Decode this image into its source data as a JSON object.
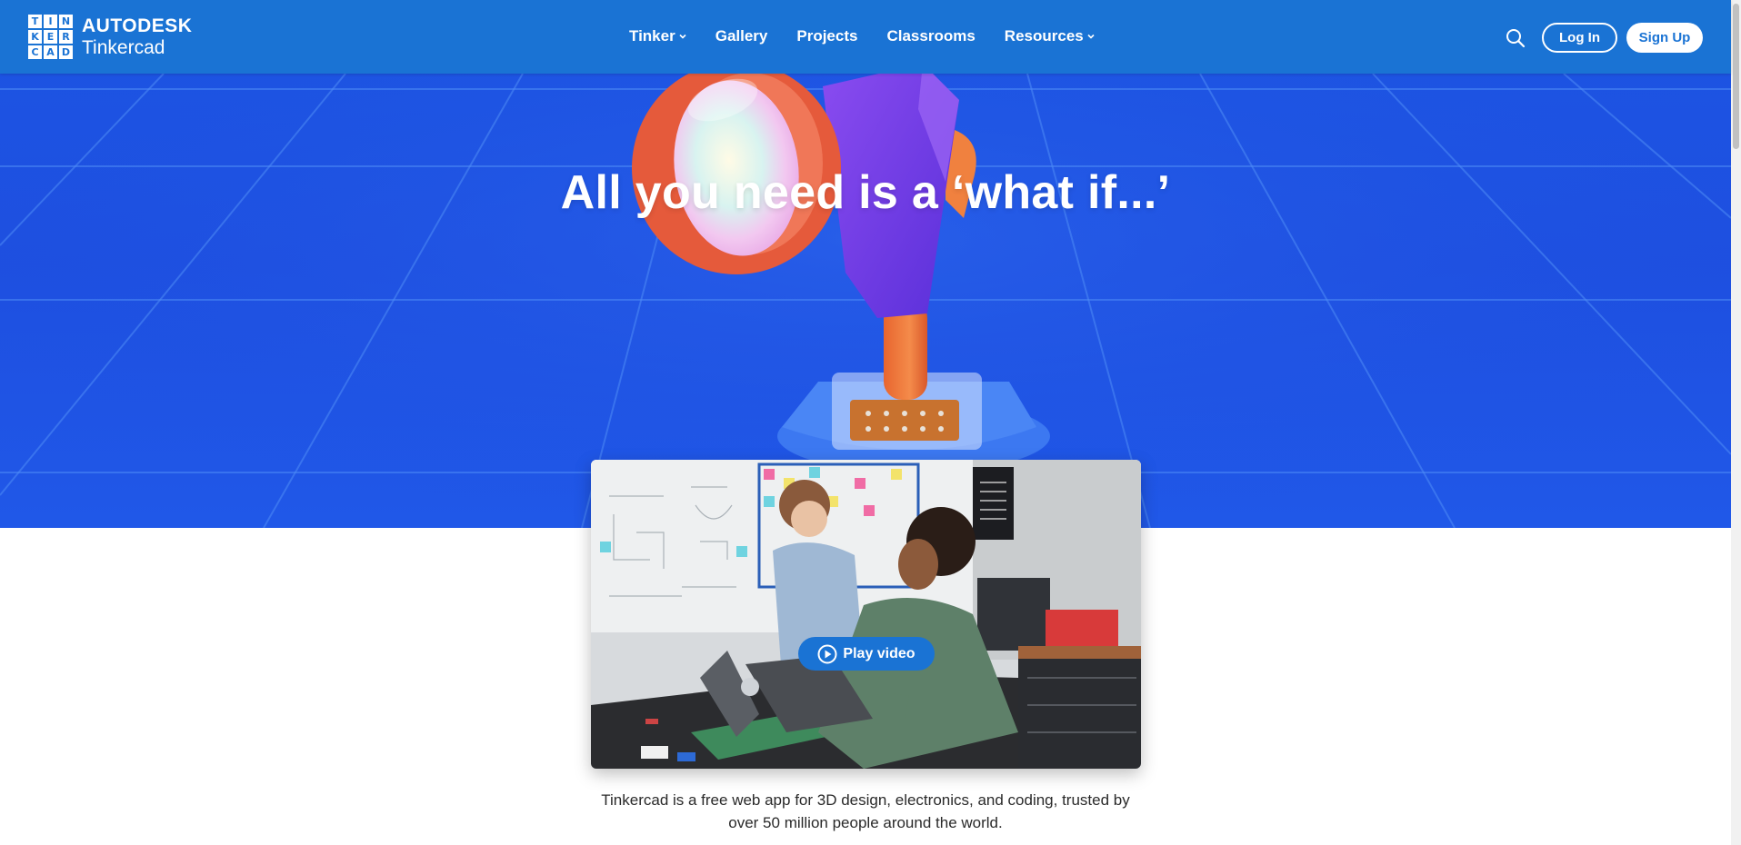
{
  "logo": {
    "letters": [
      "T",
      "I",
      "N",
      "K",
      "E",
      "R",
      "C",
      "A",
      "D"
    ],
    "brand": "AUTODESK",
    "product": "Tinkercad"
  },
  "nav": {
    "items": [
      {
        "label": "Tinker",
        "has_dropdown": true
      },
      {
        "label": "Gallery",
        "has_dropdown": false
      },
      {
        "label": "Projects",
        "has_dropdown": false
      },
      {
        "label": "Classrooms",
        "has_dropdown": false
      },
      {
        "label": "Resources",
        "has_dropdown": true
      }
    ]
  },
  "header_actions": {
    "search_icon": "search-icon",
    "login_label": "Log In",
    "signup_label": "Sign Up"
  },
  "hero": {
    "title": "All you need is a ‘what if...’"
  },
  "video": {
    "play_label": "Play video"
  },
  "tagline": {
    "line1": "Tinkercad is a free web app for 3D design, electronics, and coding, trusted by",
    "line2": "over 50 million people around the world."
  },
  "colors": {
    "brand_blue": "#1a73d4",
    "hero_blue": "#1e4fe0",
    "text_dark": "#2a2a2a"
  }
}
